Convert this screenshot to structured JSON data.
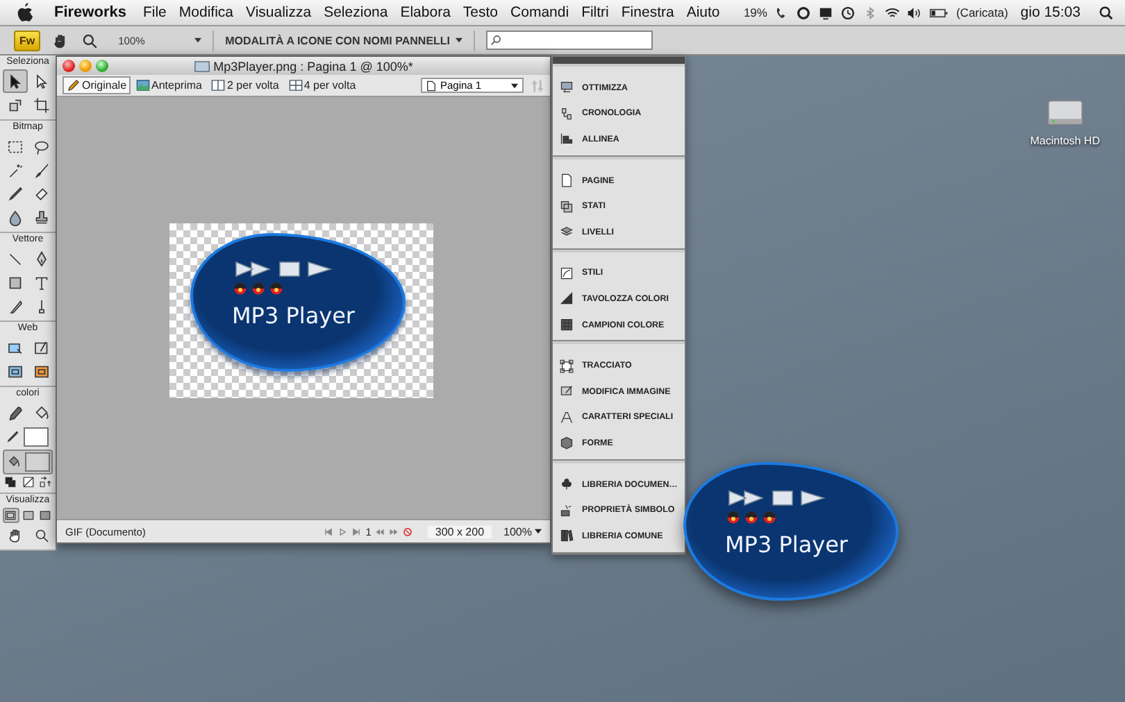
{
  "menu_bar": {
    "app_name": "Fireworks",
    "menus": [
      "File",
      "Modifica",
      "Visualizza",
      "Seleziona",
      "Elabora",
      "Testo",
      "Comandi",
      "Filtri",
      "Finestra",
      "Aiuto"
    ],
    "battery_percent": "19%",
    "battery_status": "(Caricata)",
    "clock": "gio 15:03"
  },
  "app_toolbar": {
    "app_badge": "Fw",
    "zoom": "100%",
    "workspace": "MODALITÀ A ICONE CON NOMI PANNELLI"
  },
  "tools_panel": {
    "sections": [
      {
        "title": "Seleziona",
        "tools": [
          {
            "kind": "pointer",
            "selected": true
          },
          {
            "kind": "subselect",
            "selected": false
          },
          {
            "kind": "scale",
            "selected": false
          },
          {
            "kind": "crop",
            "selected": false
          }
        ]
      },
      {
        "title": "Bitmap",
        "tools": [
          {
            "kind": "marquee",
            "selected": false
          },
          {
            "kind": "lasso",
            "selected": false
          },
          {
            "kind": "wand",
            "selected": false
          },
          {
            "kind": "brush",
            "selected": false
          },
          {
            "kind": "pencil",
            "selected": false
          },
          {
            "kind": "eraser",
            "selected": false
          },
          {
            "kind": "blur",
            "selected": false
          },
          {
            "kind": "stamp",
            "selected": false
          }
        ]
      },
      {
        "title": "Vettore",
        "tools": [
          {
            "kind": "line",
            "selected": false
          },
          {
            "kind": "pen",
            "selected": false
          },
          {
            "kind": "rect",
            "selected": false
          },
          {
            "kind": "text",
            "selected": false
          },
          {
            "kind": "knife",
            "selected": false
          },
          {
            "kind": "freeform",
            "selected": false
          }
        ]
      },
      {
        "title": "Web",
        "tools": [
          {
            "kind": "hotspot",
            "selected": false
          },
          {
            "kind": "slice",
            "selected": false
          },
          {
            "kind": "hide-slices",
            "selected": false
          },
          {
            "kind": "show-slices",
            "selected": false
          }
        ]
      },
      {
        "title": "colori",
        "tools": [
          {
            "kind": "eyedropper",
            "selected": false
          },
          {
            "kind": "bucket",
            "selected": false
          },
          {
            "kind": "stroke-color",
            "selected": false
          },
          {
            "kind": "fill-color",
            "selected": true
          },
          {
            "kind": "default-colors",
            "selected": false
          },
          {
            "kind": "no-color",
            "selected": false
          },
          {
            "kind": "swap-colors",
            "selected": false
          }
        ]
      },
      {
        "title": "Visualizza",
        "tools": [
          {
            "kind": "mode-standard",
            "selected": true
          },
          {
            "kind": "mode-menu",
            "selected": false
          },
          {
            "kind": "mode-full",
            "selected": false
          },
          {
            "kind": "hand",
            "selected": false
          },
          {
            "kind": "zoom",
            "selected": false
          }
        ]
      }
    ]
  },
  "document": {
    "title": "Mp3Player.png : Pagina 1 @ 100%*",
    "view_tabs": [
      {
        "label": "Originale",
        "selected": true
      },
      {
        "label": "Anteprima",
        "selected": false
      },
      {
        "label": "2 per volta",
        "selected": false
      },
      {
        "label": "4 per volta",
        "selected": false
      }
    ],
    "page": "Pagina 1",
    "artwork_label": "MP3 Player",
    "status": {
      "format": "GIF (Documento)",
      "frame": "1",
      "size": "300 x 200",
      "zoom": "100%"
    }
  },
  "panels": {
    "groups": [
      {
        "items": [
          "OTTIMIZZA",
          "CRONOLOGIA",
          "ALLINEA"
        ]
      },
      {
        "items": [
          "PAGINE",
          "STATI",
          "LIVELLI"
        ]
      },
      {
        "items": [
          "STILI",
          "TAVOLOZZA COLORI",
          "CAMPIONI COLORE"
        ]
      },
      {
        "items": [
          "TRACCIATO",
          "MODIFICA IMMAGINE",
          "CARATTERI SPECIALI",
          "FORME"
        ]
      },
      {
        "items": [
          "LIBRERIA DOCUMEN…",
          "PROPRIETÀ SIMBOLO",
          "LIBRERIA COMUNE"
        ]
      }
    ]
  },
  "desktop": {
    "drive_label": "Macintosh HD",
    "widget_label": "MP3 Player"
  }
}
